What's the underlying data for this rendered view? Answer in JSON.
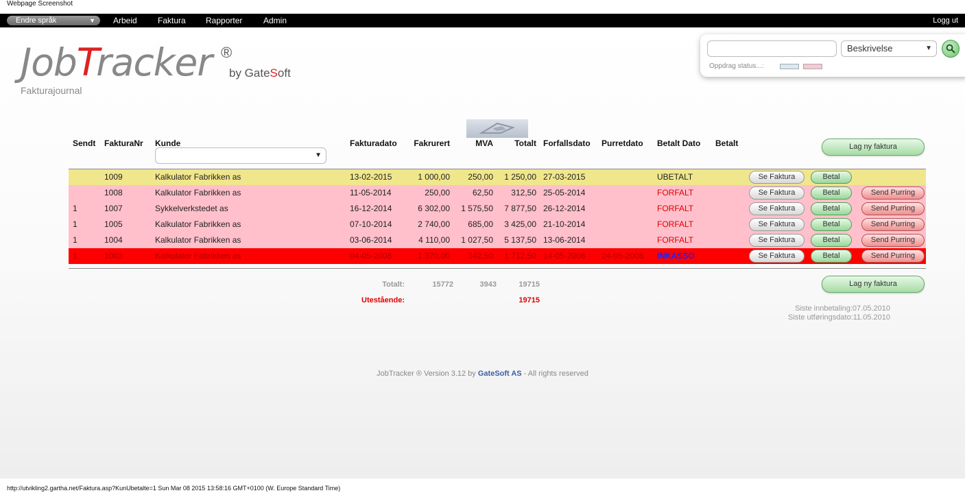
{
  "caption": "Webpage Screenshot",
  "nav": {
    "language": "Endre språk",
    "items": [
      "Arbeid",
      "Faktura",
      "Rapporter",
      "Admin"
    ],
    "logout": "Logg ut"
  },
  "brand": {
    "logo_part1": "Job",
    "logo_part2": "T",
    "logo_part3": "racker",
    "registered": "®",
    "by_prefix": "by Gate",
    "by_red": "S",
    "by_suffix": "oft",
    "subtitle": "Fakturajournal"
  },
  "search": {
    "value": "",
    "field": "Beskrivelse",
    "status_label": "Oppdrag status...:",
    "status_colors": [
      "#d6eaf4",
      "#f9c8d2"
    ]
  },
  "table": {
    "headers": {
      "sendt": "Sendt",
      "faktura_nr": "FakturaNr",
      "kunde": "Kunde",
      "fakturadato": "Fakturadato",
      "fakturert": "Fakrurert",
      "mva": "MVA",
      "totalt": "Totalt",
      "forfallsdato": "Forfallsdato",
      "purretdato": "Purretdato",
      "betalt_dato": "Betalt Dato",
      "betalt": "Betalt"
    },
    "rows": [
      {
        "sendt": "",
        "nr": "1009",
        "kunde": "Kalkulator Fabrikken as",
        "fakturadato": "13-02-2015",
        "fakturert": "1 000,00",
        "mva": "250,00",
        "totalt": "1 250,00",
        "forfall": "27-03-2015",
        "purret": "",
        "status": "UBETALT",
        "view": "Se Faktura",
        "pay": "Betal",
        "reminder": ""
      },
      {
        "sendt": "",
        "nr": "1008",
        "kunde": "Kalkulator Fabrikken as",
        "fakturadato": "11-05-2014",
        "fakturert": "250,00",
        "mva": "62,50",
        "totalt": "312,50",
        "forfall": "25-05-2014",
        "purret": "",
        "status": "FORFALT",
        "view": "Se Faktura",
        "pay": "Betal",
        "reminder": "Send Purring"
      },
      {
        "sendt": "1",
        "nr": "1007",
        "kunde": "Sykkelverkstedet as",
        "fakturadato": "16-12-2014",
        "fakturert": "6 302,00",
        "mva": "1 575,50",
        "totalt": "7 877,50",
        "forfall": "26-12-2014",
        "purret": "",
        "status": "FORFALT",
        "view": "Se Faktura",
        "pay": "Betal",
        "reminder": "Send Purring"
      },
      {
        "sendt": "1",
        "nr": "1005",
        "kunde": "Kalkulator Fabrikken as",
        "fakturadato": "07-10-2014",
        "fakturert": "2 740,00",
        "mva": "685,00",
        "totalt": "3 425,00",
        "forfall": "21-10-2014",
        "purret": "",
        "status": "FORFALT",
        "view": "Se Faktura",
        "pay": "Betal",
        "reminder": "Send Purring"
      },
      {
        "sendt": "1",
        "nr": "1004",
        "kunde": "Kalkulator Fabrikken as",
        "fakturadato": "03-06-2014",
        "fakturert": "4 110,00",
        "mva": "1 027,50",
        "totalt": "5 137,50",
        "forfall": "13-06-2014",
        "purret": "",
        "status": "FORFALT",
        "view": "Se Faktura",
        "pay": "Betal",
        "reminder": "Send Purring"
      },
      {
        "sendt": "1",
        "nr": "1003",
        "kunde": "Kalkulator Fabrikken as",
        "fakturadato": "04-05-2008",
        "fakturert": "1 370,00",
        "mva": "342,50",
        "totalt": "1 712,50",
        "forfall": "14-05-2008",
        "purret": "24-05-2008",
        "status": "INKASSO",
        "view": "Se Faktura",
        "pay": "Betal",
        "reminder": "Send Purring"
      }
    ],
    "row_colors": {
      "UBETALT": "#f0e68c",
      "FORFALT": "#ffc0cb",
      "INKASSO": "#ff0000"
    },
    "status_colors": {
      "UBETALT": "#222222",
      "FORFALT": "#dd0000",
      "INKASSO": "#2222ee"
    }
  },
  "new_invoice_label": "Lag ny faktura",
  "totals": {
    "label": "Totalt:",
    "fakturert": "15772",
    "mva": "3943",
    "totalt": "19715",
    "outstanding_label": "Utestående:",
    "outstanding": "19715"
  },
  "last_info": {
    "payment": "Siste innbetaling:07.05.2010",
    "execution": "Siste utføringsdato:11.05.2010"
  },
  "footer": {
    "prefix": "JobTracker ® Version 3.12 by ",
    "company": "GateSoft AS",
    "suffix": " - All rights reserved"
  },
  "status_url": "http://utvikling2.gartha.net/Faktura.asp?KunUbetalte=1 Sun Mar 08 2015 13:58:16 GMT+0100 (W. Europe Standard Time)"
}
